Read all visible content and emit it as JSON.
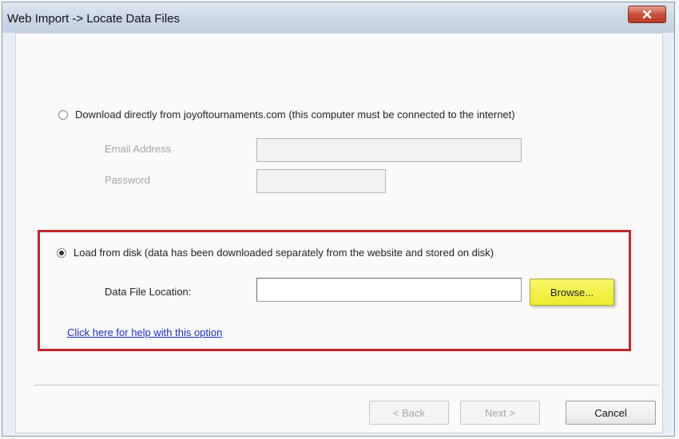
{
  "window": {
    "title": "Web Import -> Locate Data Files",
    "close_icon": "close-icon"
  },
  "download_option": {
    "label": "Download directly from joyoftournaments.com (this computer must be connected to the internet)",
    "selected": false,
    "email_label": "Email Address",
    "email_value": "",
    "password_label": "Password",
    "password_value": ""
  },
  "disk_option": {
    "label": "Load from disk (data has been downloaded separately from the website and stored on disk)",
    "selected": true,
    "file_location_label": "Data File Location:",
    "file_location_value": "",
    "browse_label": "Browse...",
    "help_link": "Click here for help with this option",
    "highlight_color": "#c0272d",
    "browse_highlight_color": "#ecec2c"
  },
  "footer": {
    "back_label": "< Back",
    "next_label": "Next >",
    "cancel_label": "Cancel"
  }
}
